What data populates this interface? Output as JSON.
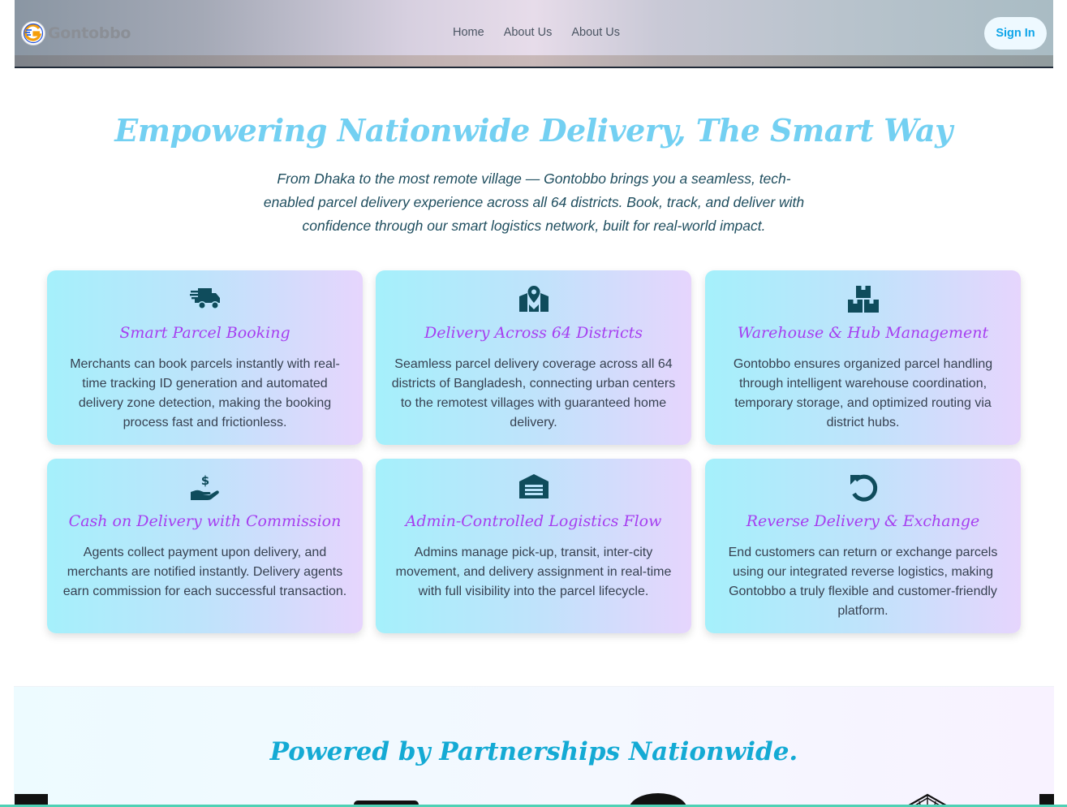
{
  "nav": {
    "brand": "Gontobbo",
    "links": [
      "Home",
      "About Us",
      "About Us"
    ],
    "signin_label": "Sign In"
  },
  "hero": {
    "title": "Empowering Nationwide Delivery, The Smart Way",
    "subtitle": "From Dhaka to the most remote village — Gontobbo brings you a seamless, tech-enabled parcel delivery experience across all 64 districts. Book, track, and deliver with confidence through our smart logistics network, built for real-world impact."
  },
  "features": [
    {
      "icon": "shipping-fast-icon",
      "title": "Smart Parcel Booking",
      "description": "Merchants can book parcels instantly with real-time tracking ID generation and automated delivery zone detection, making the booking process fast and frictionless."
    },
    {
      "icon": "map-location-icon",
      "title": "Delivery Across 64 Districts",
      "description": "Seamless parcel delivery coverage across all 64 districts of Bangladesh, connecting urban centers to the remotest villages with guaranteed home delivery."
    },
    {
      "icon": "boxes-icon",
      "title": "Warehouse & Hub Management",
      "description": "Gontobbo ensures organized parcel handling through intelligent warehouse coordination, temporary storage, and optimized routing via district hubs."
    },
    {
      "icon": "hand-holding-dollar-icon",
      "title": "Cash on Delivery with Commission",
      "description": "Agents collect payment upon delivery, and merchants are notified instantly. Delivery agents earn commission for each successful transaction."
    },
    {
      "icon": "warehouse-garage-icon",
      "title": "Admin-Controlled Logistics Flow",
      "description": "Admins manage pick-up, transit, inter-city movement, and delivery assignment in real-time with full visibility into the parcel lifecycle."
    },
    {
      "icon": "undo-icon",
      "title": "Reverse Delivery & Exchange",
      "description": "End customers can return or exchange parcels using our integrated reverse logistics, making Gontobbo a truly flexible and customer-friendly platform."
    }
  ],
  "partners": {
    "title": "Powered by Partnerships Nationwide."
  },
  "colors": {
    "accent": "#14aad4",
    "card_title": "#a63ff0",
    "icon": "#0f4c5c",
    "hero_title": "#73d0f2"
  }
}
